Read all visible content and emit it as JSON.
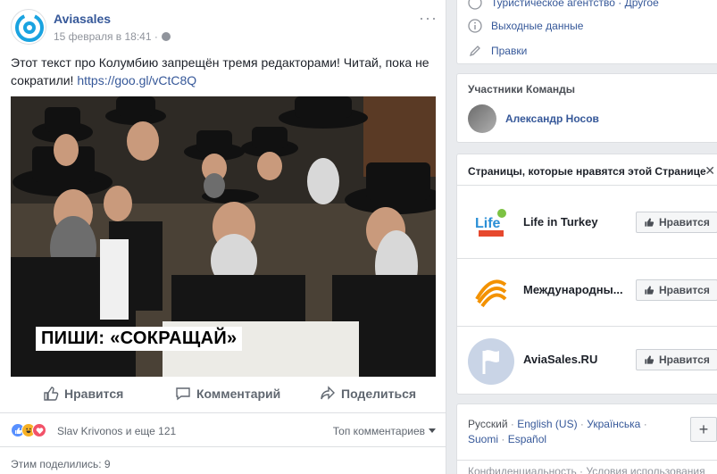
{
  "post": {
    "page_name": "Aviasales",
    "date": "15 февраля в 18:41 ·",
    "menu": "···",
    "text_main": "Этот текст про Колумбию запрещён тремя редакторами! Читай, пока не сократили!",
    "link": "https://goo.gl/vCtC8Q",
    "image_caption": "ПИШИ: «СОКРАЩАЙ»",
    "actions": {
      "like": "Нравится",
      "comment": "Комментарий",
      "share": "Поделиться"
    },
    "reactions": {
      "likers": "Slav Krivonos и еще 121",
      "sort": "Топ комментариев"
    },
    "shares": "Этим поделились: 9"
  },
  "sidebar": {
    "about": {
      "category": "Туристическое агентство · Другое",
      "imprint": "Выходные данные",
      "edit": "Правки"
    },
    "team": {
      "title": "Участники Команды",
      "member": "Александр Носов"
    },
    "liked_pages": {
      "title": "Страницы, которые нравятся этой Странице",
      "close": "✕",
      "button_label": "Нравится",
      "items": [
        {
          "name": "Life in Turkey"
        },
        {
          "name": "Международны..."
        },
        {
          "name": "AviaSales.RU"
        }
      ]
    },
    "languages": {
      "current": "Русский",
      "sep": "·",
      "list": [
        "English (US)",
        "Українська",
        "Suomi",
        "Español"
      ],
      "plus": "+"
    },
    "footer": "Конфиденциальность · Условия использования"
  },
  "colors": {
    "link": "#365899",
    "background": "#e9ebee",
    "aviasales_blue": "#1aa3e0"
  }
}
